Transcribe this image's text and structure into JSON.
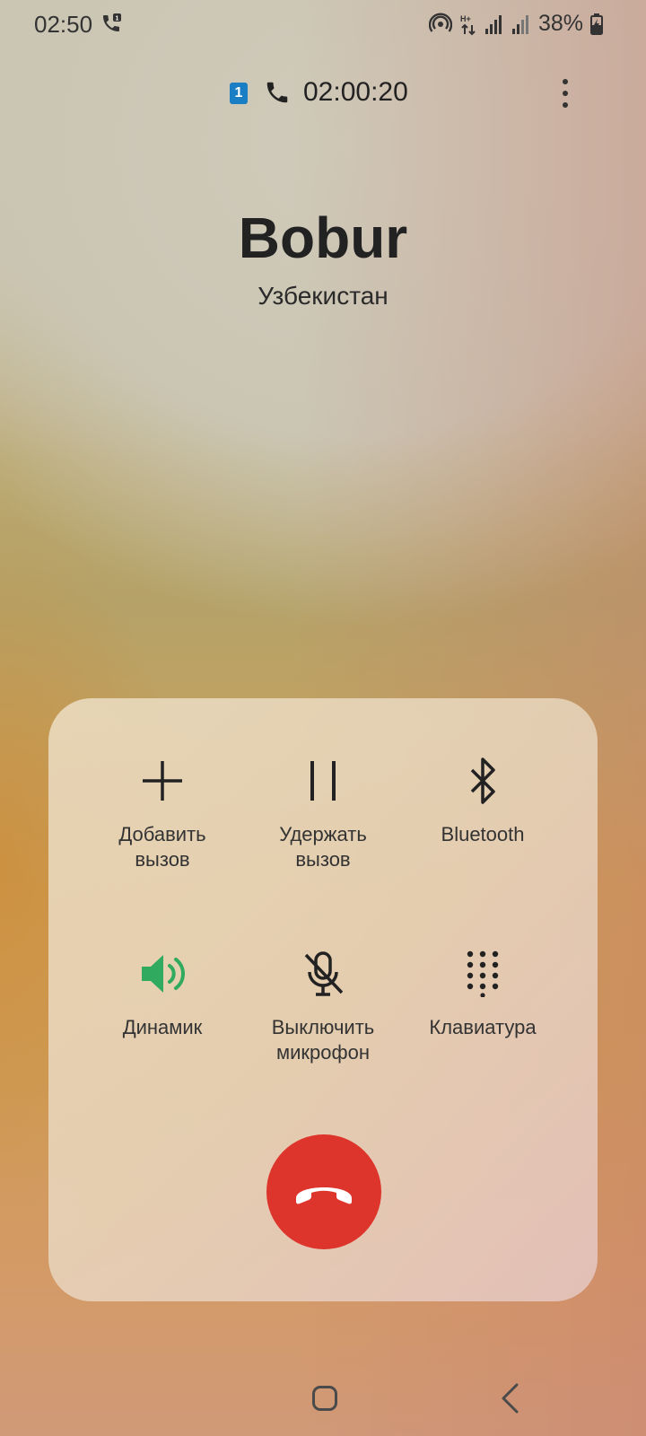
{
  "status_bar": {
    "time": "02:50",
    "battery": "38%"
  },
  "call": {
    "sim": "1",
    "timer": "02:00:20",
    "contact_name": "Bobur",
    "country": "Узбекистан"
  },
  "controls": [
    {
      "label": "Добавить\nвызов",
      "icon": "plus-icon"
    },
    {
      "label": "Удержать\nвызов",
      "icon": "pause-icon"
    },
    {
      "label": "Bluetooth",
      "icon": "bluetooth-icon"
    },
    {
      "label": "Динамик",
      "icon": "speaker-icon",
      "active": true
    },
    {
      "label": "Выключить\nмикрофон",
      "icon": "mic-off-icon"
    },
    {
      "label": "Клавиатура",
      "icon": "keypad-icon"
    }
  ],
  "colors": {
    "accent_green": "#2faa5e",
    "end_call_red": "#dd342b",
    "sim_badge_blue": "#1a7ec4"
  }
}
